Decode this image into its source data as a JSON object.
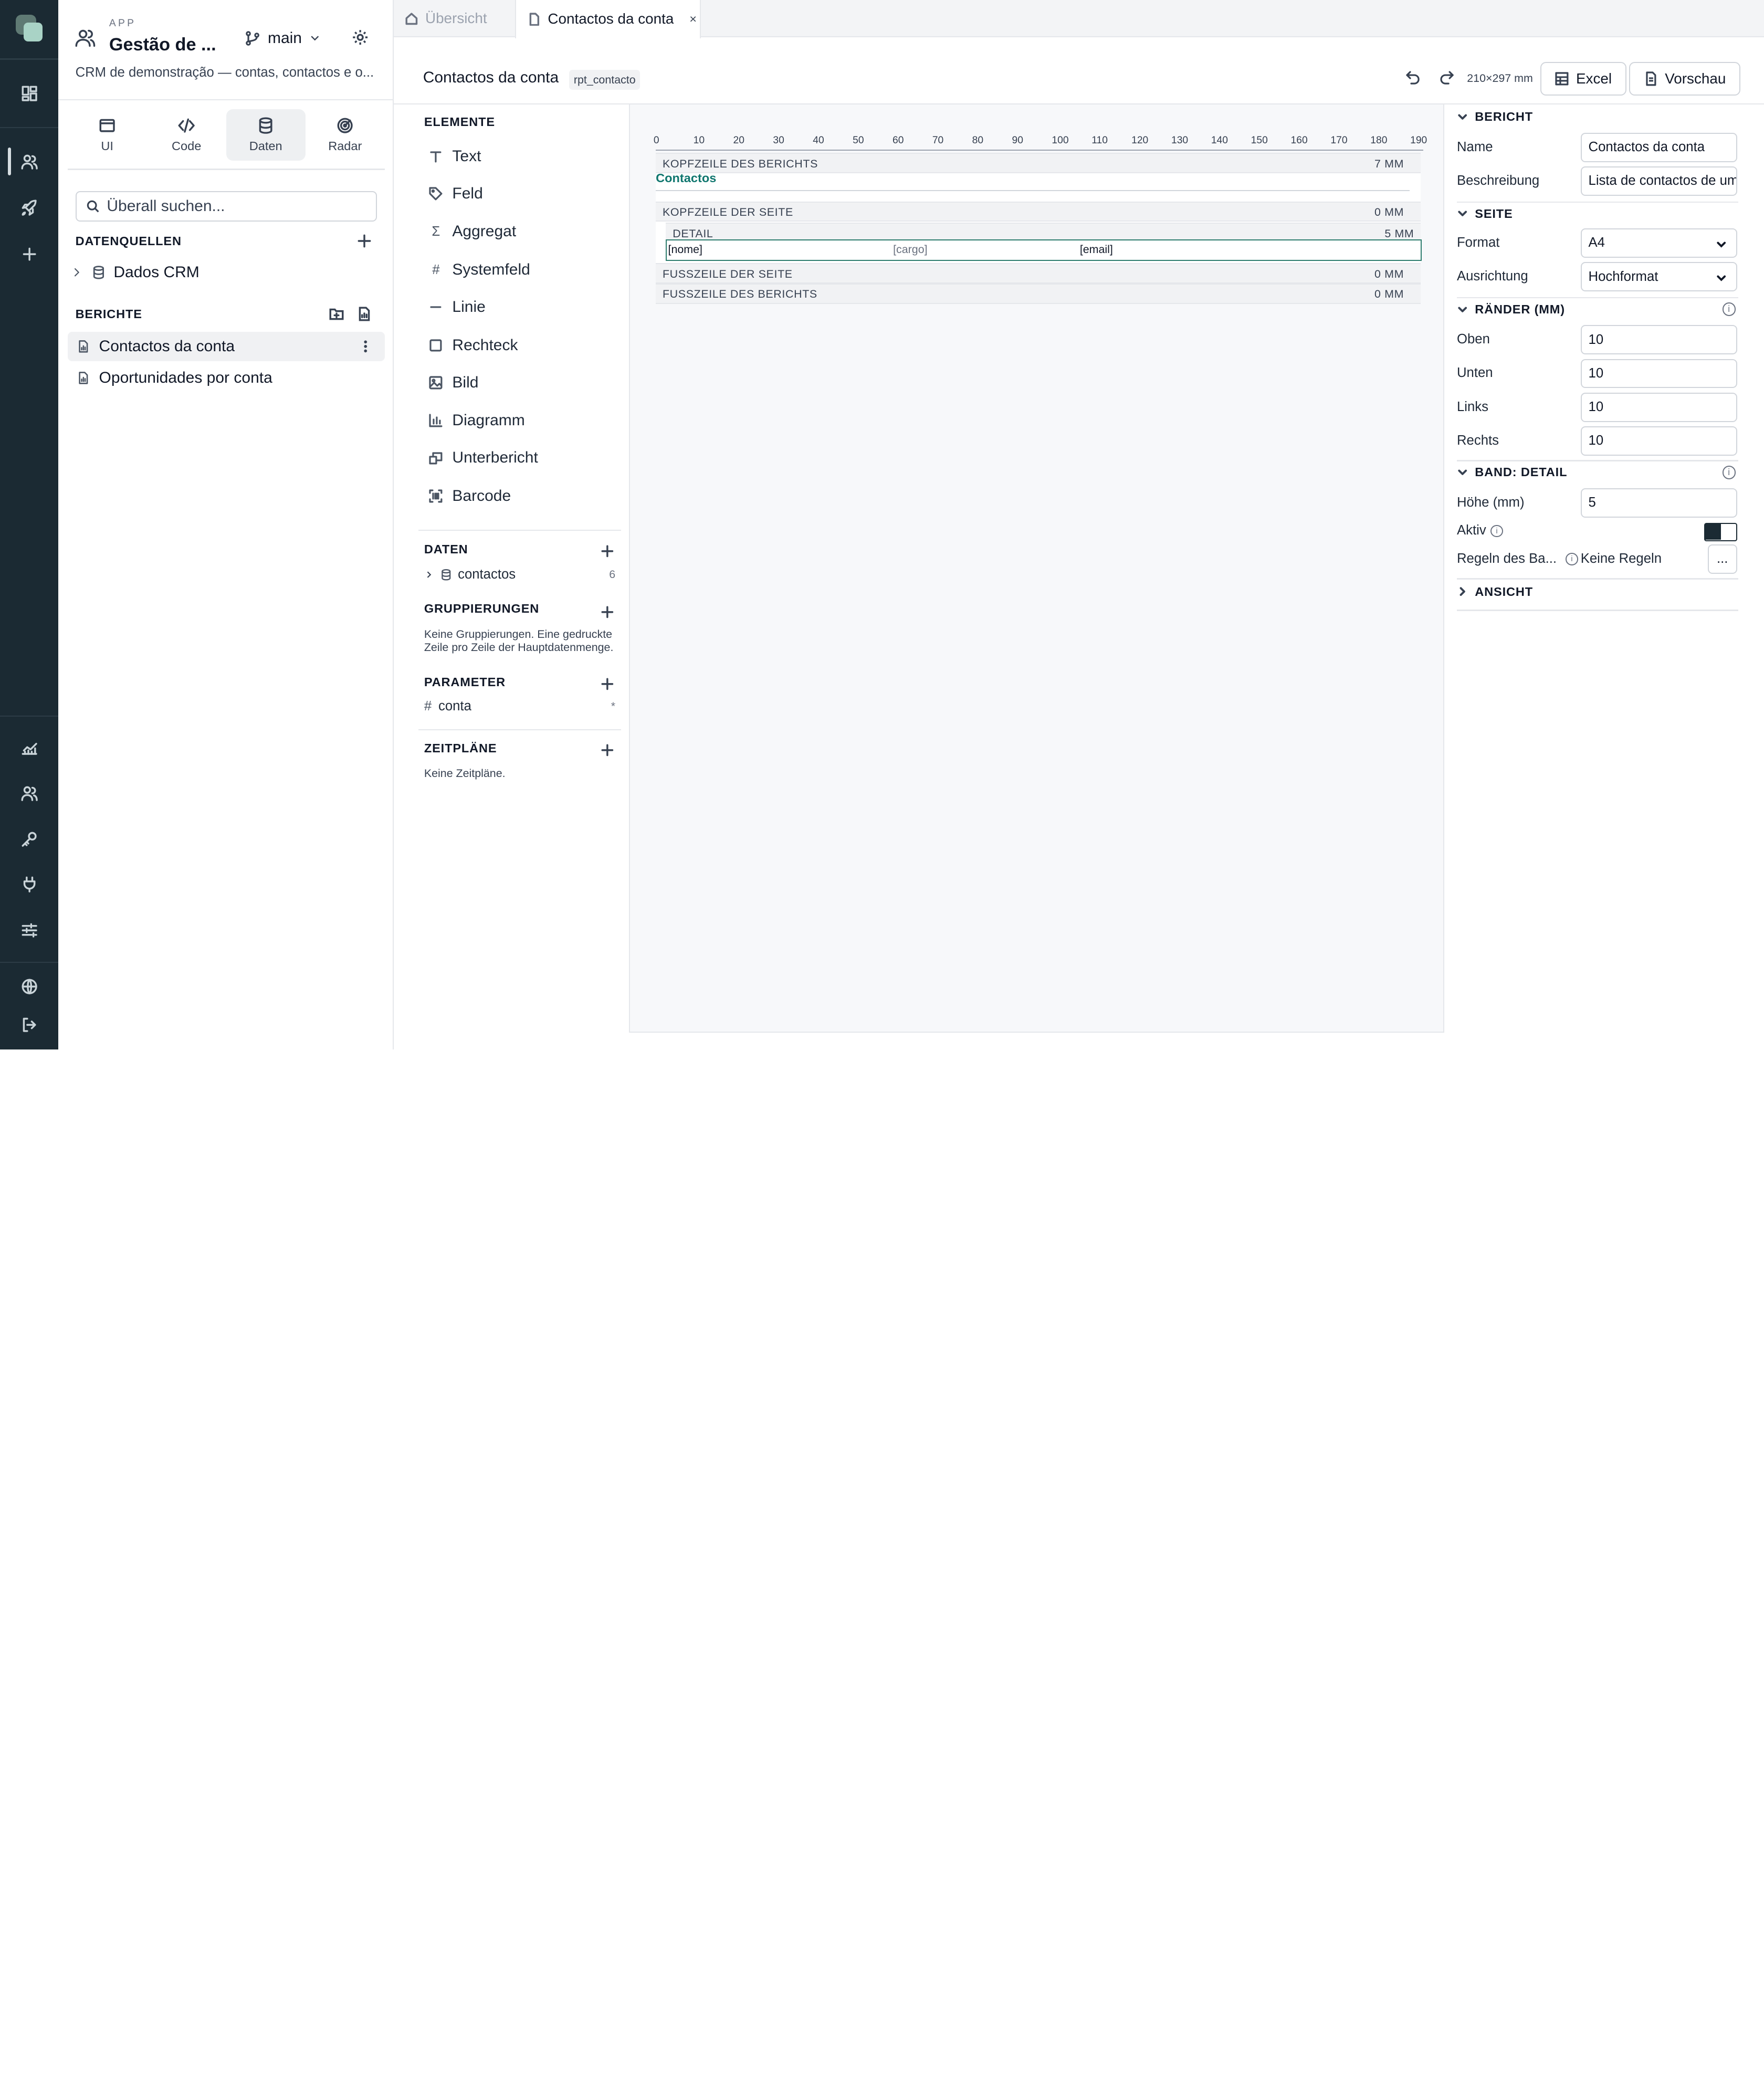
{
  "app": {
    "label": "APP",
    "title": "Gestão de ...",
    "branch": "main",
    "description": "CRM de demonstração — contas, contactos e o..."
  },
  "modes": [
    {
      "label": "UI",
      "icon": "window-icon"
    },
    {
      "label": "Code",
      "icon": "code-icon"
    },
    {
      "label": "Daten",
      "icon": "database-icon"
    },
    {
      "label": "Radar",
      "icon": "radar-icon"
    }
  ],
  "search": {
    "placeholder": "Überall suchen..."
  },
  "datasources": {
    "title": "DATENQUELLEN",
    "items": [
      "Dados CRM"
    ]
  },
  "reports": {
    "title": "BERICHTE",
    "items": [
      "Contactos da conta",
      "Oportunidades por conta"
    ]
  },
  "tabs": [
    {
      "label": "Übersicht",
      "active": false
    },
    {
      "label": "Contactos da conta",
      "active": true,
      "close": "×"
    }
  ],
  "toolbar": {
    "title": "Contactos da conta",
    "badge": "rpt_contacto",
    "page_size": "210×297 mm",
    "excel_label": "Excel",
    "preview_label": "Vorschau"
  },
  "elements": {
    "title": "ELEMENTE",
    "items": [
      "Text",
      "Feld",
      "Aggregat",
      "Systemfeld",
      "Linie",
      "Rechteck",
      "Bild",
      "Diagramm",
      "Unterbericht",
      "Barcode"
    ]
  },
  "data_section": {
    "title": "DATEN",
    "items": [
      {
        "name": "contactos",
        "count": "6"
      }
    ]
  },
  "groupings": {
    "title": "GRUPPIERUNGEN",
    "note": "Keine Gruppierungen. Eine gedruckte Zeile pro Zeile der Hauptdatenmenge."
  },
  "parameters": {
    "title": "PARAMETER",
    "items": [
      {
        "name": "conta",
        "marker": "*"
      }
    ]
  },
  "schedules": {
    "title": "ZEITPLÄNE",
    "note": "Keine Zeitpläne."
  },
  "ruler": [
    "0",
    "10",
    "20",
    "30",
    "40",
    "50",
    "60",
    "70",
    "80",
    "90",
    "100",
    "110",
    "120",
    "130",
    "140",
    "150",
    "160",
    "170",
    "180",
    "190"
  ],
  "bands": {
    "report_header": {
      "label": "KOPFZEILE DES BERICHTS",
      "height": "7 MM",
      "content": "Contactos"
    },
    "page_header": {
      "label": "KOPFZEILE DER SEITE",
      "height": "0 MM"
    },
    "detail": {
      "label": "DETAIL",
      "height": "5 MM",
      "fields": [
        "[nome]",
        "[cargo]",
        "[email]"
      ]
    },
    "page_footer": {
      "label": "FUSSZEILE DER SEITE",
      "height": "0 MM"
    },
    "report_footer": {
      "label": "FUSSZEILE DES BERICHTS",
      "height": "0 MM"
    }
  },
  "inspector": {
    "report": {
      "title": "BERICHT",
      "name_label": "Name",
      "name_value": "Contactos da conta",
      "desc_label": "Beschreibung",
      "desc_value": "Lista de contactos de uma conta"
    },
    "page": {
      "title": "SEITE",
      "format_label": "Format",
      "format_value": "A4",
      "orientation_label": "Ausrichtung",
      "orientation_value": "Hochformat"
    },
    "margins": {
      "title": "RÄNDER (MM)",
      "top_label": "Oben",
      "top": "10",
      "bottom_label": "Unten",
      "bottom": "10",
      "left_label": "Links",
      "left": "10",
      "right_label": "Rechts",
      "right": "10"
    },
    "band": {
      "title": "BAND: DETAIL",
      "height_label": "Höhe (mm)",
      "height": "5",
      "active_label": "Aktiv",
      "active": true,
      "rules_label": "Regeln des Ba...",
      "rules_value": "Keine Regeln",
      "more": "..."
    },
    "view": {
      "title": "ANSICHT"
    }
  },
  "colors": {
    "rail": "#1b2a33",
    "accent": "#0f766e",
    "detail_border": "#2e7d6e"
  }
}
